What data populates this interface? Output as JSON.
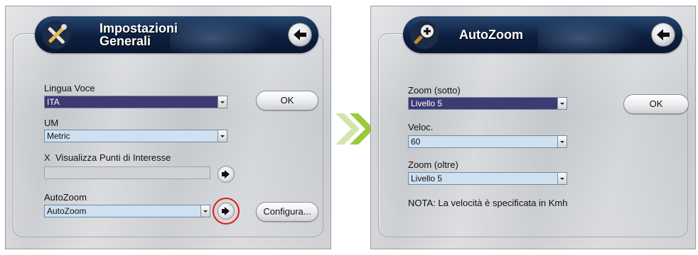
{
  "left_panel": {
    "title_line1": "Impostazioni",
    "title_line2": "Generali",
    "lingua_label": "Lingua Voce",
    "lingua_value": "ITA",
    "ok_label": "OK",
    "um_label": "UM",
    "um_value": "Metric",
    "poi_checkbox_mark": "X",
    "poi_label": "Visualizza Punti di Interesse",
    "poi_field_value": "",
    "autozoom_label": "AutoZoom",
    "autozoom_value": "AutoZoom",
    "configura_label": "Configura..."
  },
  "right_panel": {
    "title": "AutoZoom",
    "zoom_sotto_label": "Zoom (sotto)",
    "zoom_sotto_value": "Livello 5",
    "ok_label": "OK",
    "veloc_label": "Veloc.",
    "veloc_value": "60",
    "zoom_oltre_label": "Zoom (oltre)",
    "zoom_oltre_value": "Livello 5",
    "nota": "NOTA: La velocità è specificata in Kmh"
  },
  "icons": {
    "left_header_icon": "tools-icon",
    "right_header_icon": "zoom-in-magnifier-icon",
    "back": "back-arrow-icon",
    "next": "right-arrow-icon",
    "transition": "double-chevron-right-icon"
  },
  "colors": {
    "header_bg": "#0d1f3e",
    "selected_combo": "#3f3a72",
    "combo_bg": "#cfe0f0",
    "highlight": "#e01818",
    "chevron": "#9bc93a"
  }
}
